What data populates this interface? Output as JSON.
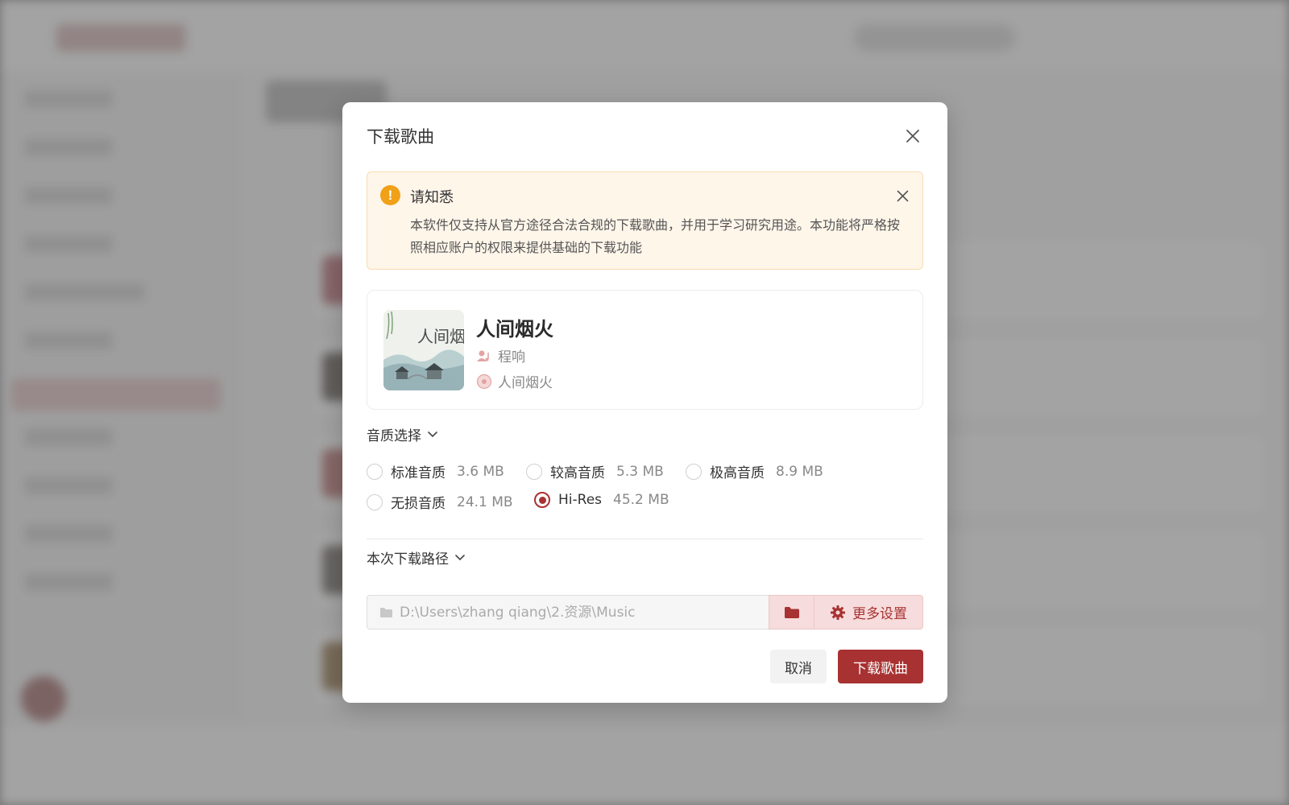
{
  "dialog": {
    "title": "下载歌曲",
    "notice": {
      "title": "请知悉",
      "body": "本软件仅支持从官方途径合法合规的下载歌曲，并用于学习研究用途。本功能将严格按照相应账户的权限来提供基础的下载功能",
      "icon": "warning-icon"
    },
    "song": {
      "name": "人间烟火",
      "artist": "程响",
      "album": "人间烟火",
      "cover_text": "人间烟火"
    },
    "quality": {
      "label": "音质选择",
      "options": [
        {
          "name": "标准音质",
          "size": "3.6 MB",
          "checked": false
        },
        {
          "name": "较高音质",
          "size": "5.3 MB",
          "checked": false
        },
        {
          "name": "极高音质",
          "size": "8.9 MB",
          "checked": false
        },
        {
          "name": "无损音质",
          "size": "24.1 MB",
          "checked": false
        },
        {
          "name": "Hi-Res",
          "size": "45.2 MB",
          "checked": true
        }
      ]
    },
    "path": {
      "label": "本次下载路径",
      "placeholder": "D:\\Users\\zhang qiang\\2.资源\\Music",
      "more_settings": "更多设置"
    },
    "buttons": {
      "cancel": "取消",
      "download": "下载歌曲"
    }
  },
  "colors": {
    "accent": "#a83232",
    "warning": "#f0a118",
    "notice_bg": "#fff6ea"
  }
}
